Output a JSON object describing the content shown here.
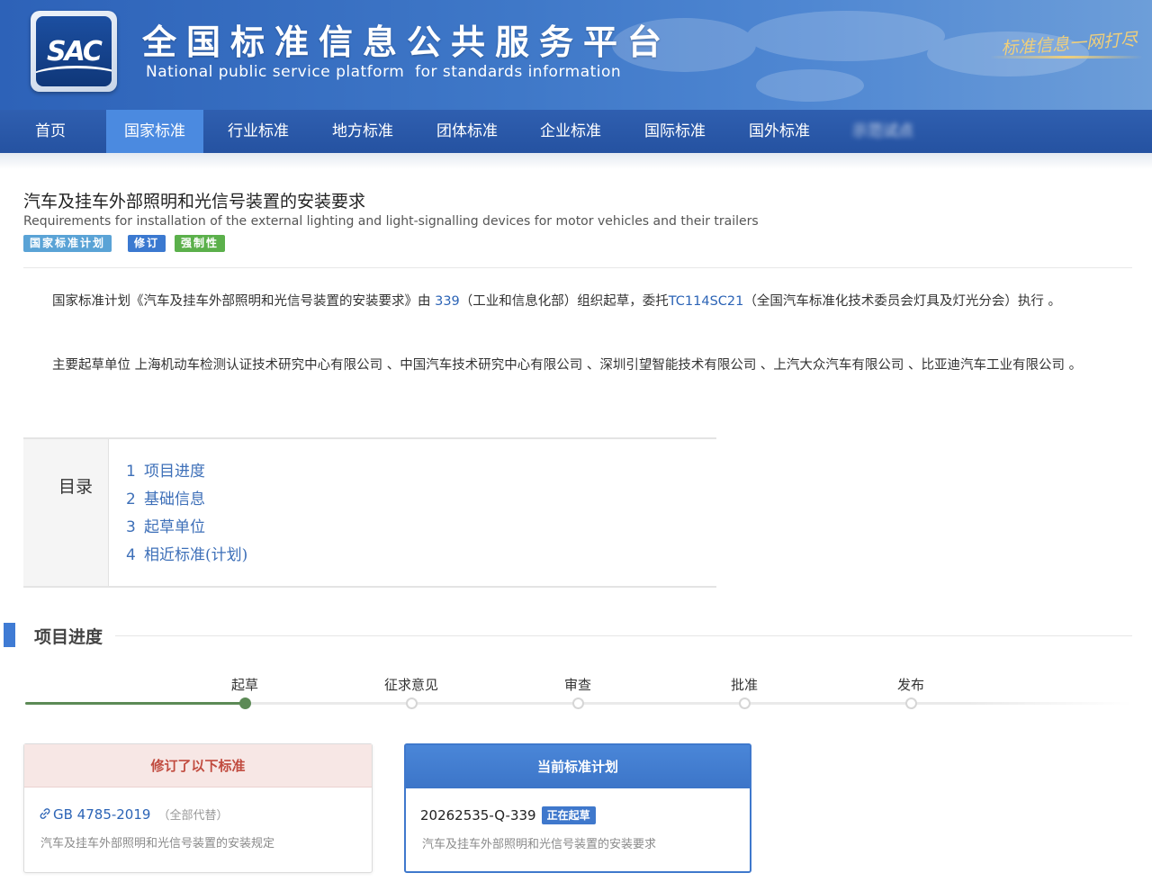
{
  "header": {
    "logo_text": "SAC",
    "title": "全国标准信息公共服务平台",
    "subtitle": "National public service platform  for standards information",
    "slogan": "标准信息一网打尽"
  },
  "nav": {
    "items": [
      {
        "label": "首页"
      },
      {
        "label": "国家标准"
      },
      {
        "label": "行业标准"
      },
      {
        "label": "地方标准"
      },
      {
        "label": "团体标准"
      },
      {
        "label": "企业标准"
      },
      {
        "label": "国际标准"
      },
      {
        "label": "国外标准"
      },
      {
        "label": "示范试点"
      }
    ],
    "active_index": 1
  },
  "standard": {
    "title_zh": "汽车及挂车外部照明和光信号装置的安装要求",
    "title_en": "Requirements for installation of the external lighting and light-signalling devices for motor vehicles and their trailers",
    "tags": [
      "国家标准计划",
      "修订",
      "强制性"
    ]
  },
  "description": {
    "p1_prefix": "国家标准计划《汽车及挂车外部照明和光信号装置的安装要求》由 ",
    "p1_org_code": "339",
    "p1_mid": "（工业和信息化部）组织起草，委托",
    "p1_tc_code": "TC114SC21",
    "p1_suffix": "（全国汽车标准化技术委员会灯具及灯光分会）执行 。",
    "p2": "主要起草单位 上海机动车检测认证技术研究中心有限公司 、中国汽车技术研究中心有限公司 、深圳引望智能技术有限公司 、上汽大众汽车有限公司 、比亚迪汽车工业有限公司 。"
  },
  "toc": {
    "label": "目录",
    "items": [
      {
        "num": "1",
        "label": "项目进度"
      },
      {
        "num": "2",
        "label": "基础信息"
      },
      {
        "num": "3",
        "label": "起草单位"
      },
      {
        "num": "4",
        "label": "相近标准(计划)"
      }
    ]
  },
  "progress": {
    "section_title": "项目进度",
    "stages": [
      "起草",
      "征求意见",
      "审查",
      "批准",
      "发布"
    ],
    "current_stage_index": 0
  },
  "cards": {
    "revised": {
      "header": "修订了以下标准",
      "code": "GB 4785-2019",
      "note": "（全部代替）",
      "desc": "汽车及挂车外部照明和光信号装置的安装规定"
    },
    "current_plan": {
      "header": "当前标准计划",
      "code": "20262535-Q-339",
      "status": "正在起草",
      "desc": "汽车及挂车外部照明和光信号装置的安装要求"
    }
  },
  "colors": {
    "header_blue": "#2d62b8",
    "nav_active": "#4b8ae0",
    "link_blue": "#2c64b6",
    "progress_green": "#5c8a56",
    "revised_header_bg": "#f7e7e5",
    "revised_header_text": "#c14b3f"
  }
}
